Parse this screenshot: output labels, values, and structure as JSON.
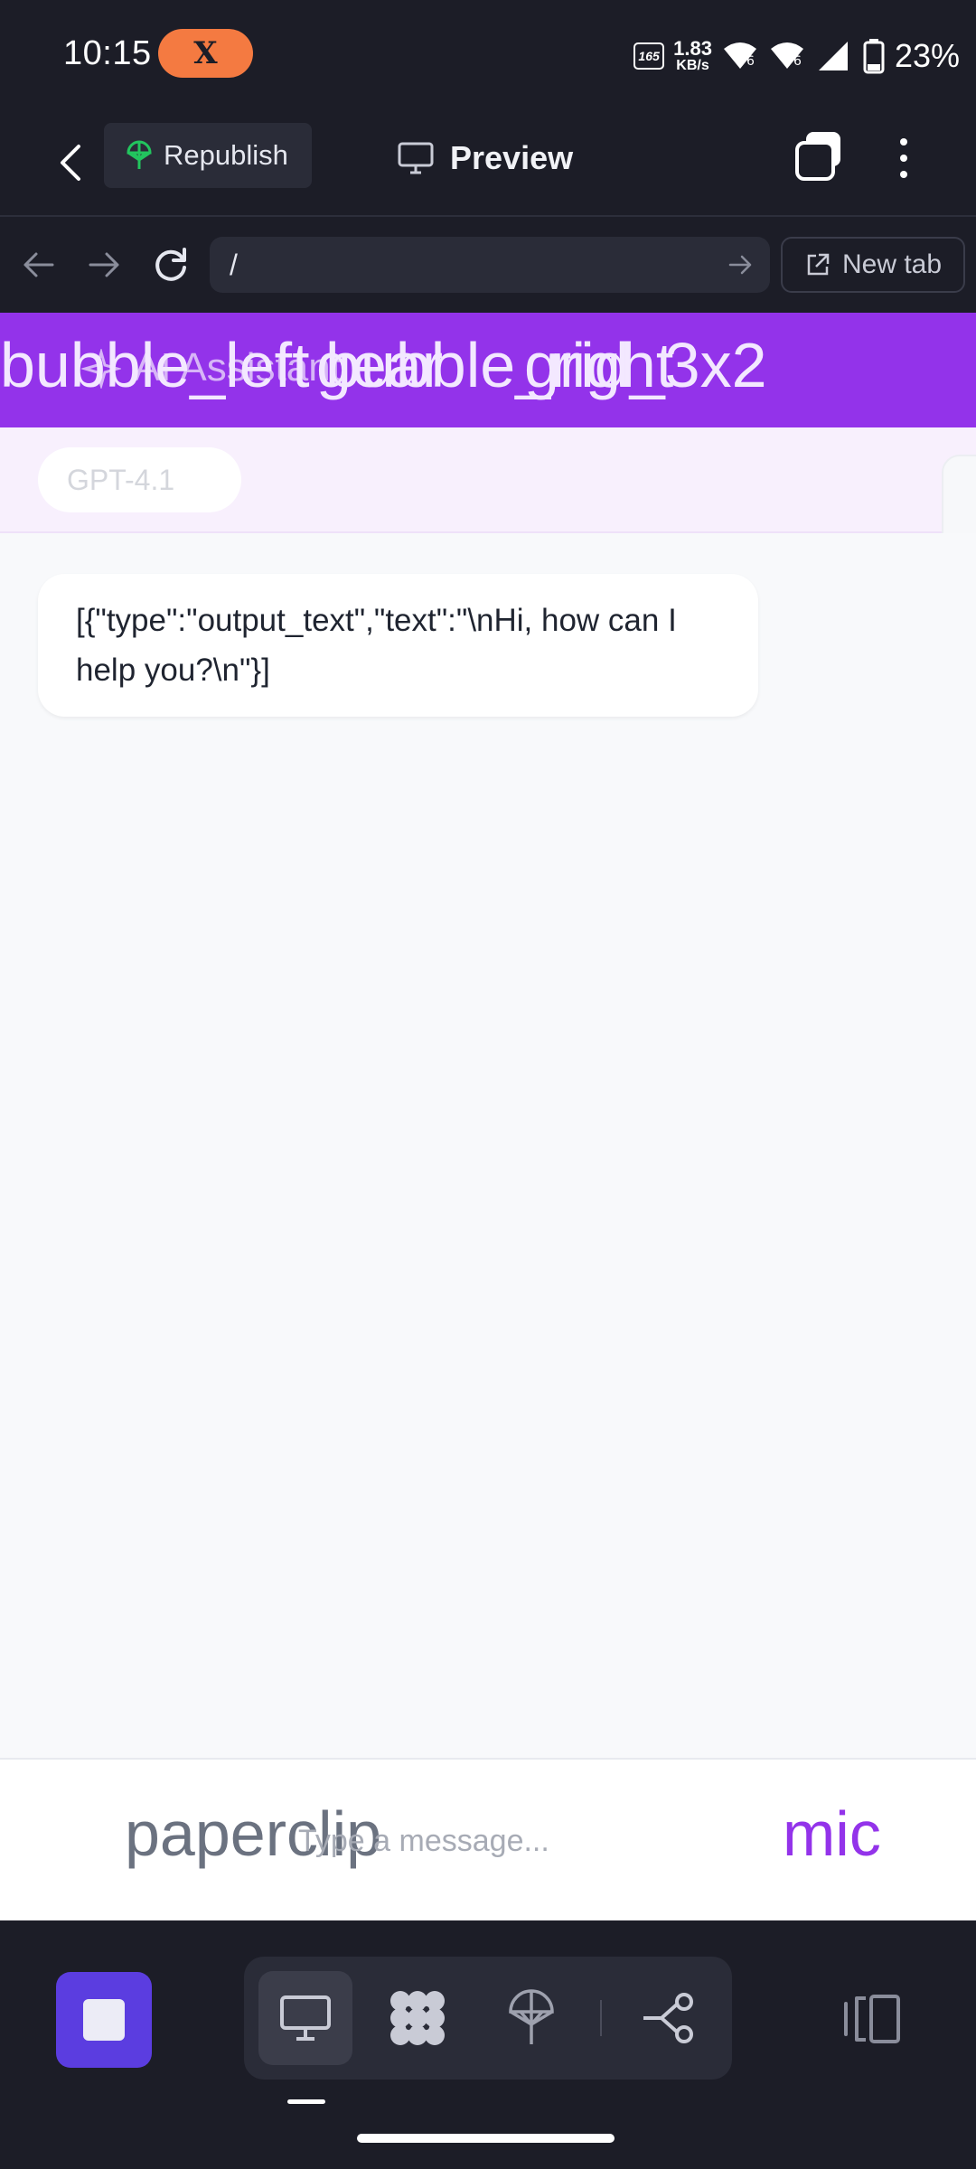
{
  "status_bar": {
    "time": "10:15",
    "app_badge": "X",
    "refresh_rate": "165",
    "net_speed_value": "1.83",
    "net_speed_unit": "KB/s",
    "battery_percent": "23%"
  },
  "topbar": {
    "republish_label": "Republish",
    "preview_label": "Preview"
  },
  "browser": {
    "url": "/",
    "new_tab_label": "New tab"
  },
  "header": {
    "title": "AI Assistant",
    "overlay_tokens": [
      "bubble_left",
      "gear",
      "bubble_right",
      "grid_3x2"
    ]
  },
  "model_selector": {
    "value": "GPT-4.1"
  },
  "chat": {
    "messages": [
      {
        "role": "assistant",
        "text": "[{\"type\":\"output_text\",\"text\":\"\\nHi, how can I help you?\\n\"}]"
      }
    ]
  },
  "input_bar": {
    "attach_icon_text": "paperclip",
    "placeholder": "Type a message...",
    "mic_icon_text": "mic"
  },
  "dock": {
    "icons": [
      "stop-icon",
      "monitor-icon",
      "grid-blob-icon",
      "publish-icon",
      "workflow-icon",
      "panel-toggle-icon"
    ]
  },
  "colors": {
    "dark_bg": "#1c1d27",
    "accent_purple": "#9333ea",
    "stop_purple": "#5b3de0",
    "republish_green": "#22c55e",
    "x_badge_orange": "#f47a41"
  }
}
